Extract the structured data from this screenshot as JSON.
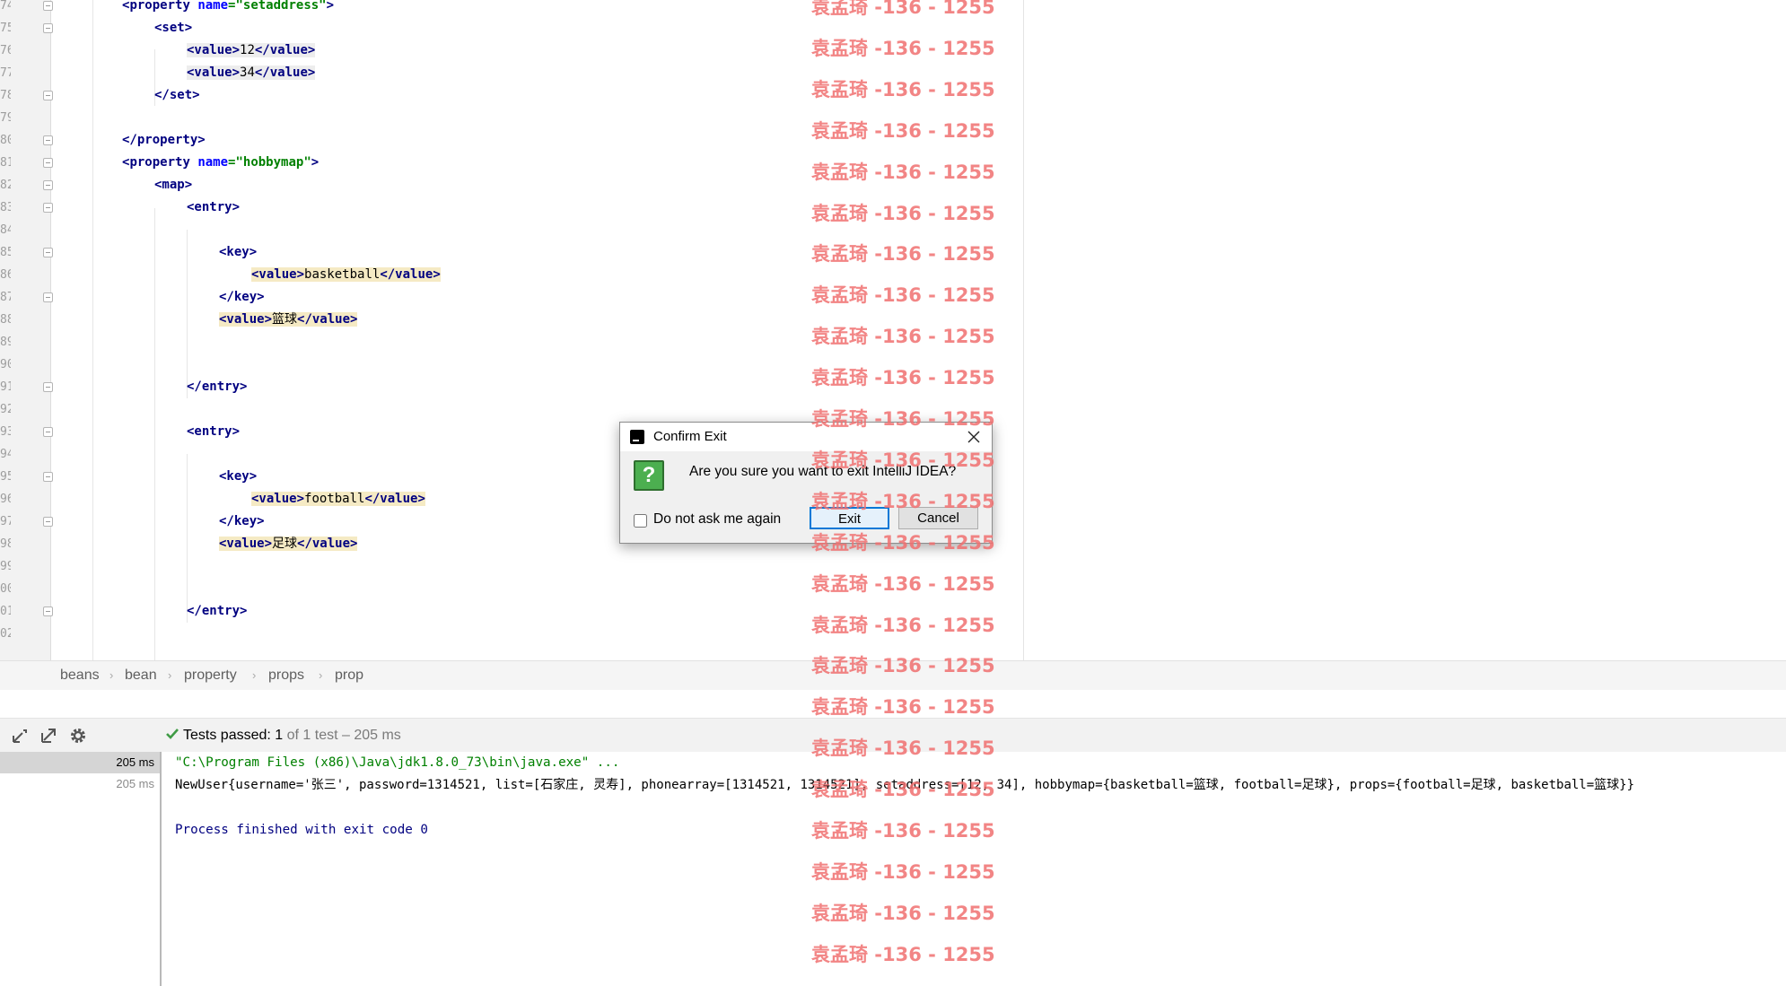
{
  "editor": {
    "line_numbers": [
      "74",
      "75",
      "76",
      "77",
      "78",
      "79",
      "80",
      "81",
      "82",
      "83",
      "84",
      "85",
      "86",
      "87",
      "88",
      "89",
      "90",
      "91",
      "92",
      "93",
      "94",
      "95",
      "96",
      "97",
      "98",
      "99",
      "00",
      "01",
      "02"
    ],
    "lines": [
      [
        {
          "t": "<",
          "c": "tag"
        },
        {
          "t": "property",
          "c": "tag"
        },
        {
          "t": " "
        },
        {
          "t": "name",
          "c": "an"
        },
        {
          "t": "=\"setaddress\"",
          "c": "av"
        },
        {
          "t": ">",
          "c": "tag"
        }
      ],
      [
        {
          "t": "<set>",
          "c": "tag"
        }
      ],
      [
        {
          "t": "<value>",
          "c": "tag"
        },
        {
          "t": "12"
        },
        {
          "t": "</value>",
          "c": "tag"
        }
      ],
      [
        {
          "t": "<value>",
          "c": "tag"
        },
        {
          "t": "34"
        },
        {
          "t": "</value>",
          "c": "tag"
        }
      ],
      [
        {
          "t": "</set>",
          "c": "tag"
        }
      ],
      [],
      [
        {
          "t": "</property>",
          "c": "tag"
        }
      ],
      [
        {
          "t": "<",
          "c": "tag"
        },
        {
          "t": "property",
          "c": "tag"
        },
        {
          "t": " "
        },
        {
          "t": "name",
          "c": "an"
        },
        {
          "t": "=\"hobbymap\"",
          "c": "av"
        },
        {
          "t": ">",
          "c": "tag"
        }
      ],
      [
        {
          "t": "<map>",
          "c": "tag"
        }
      ],
      [
        {
          "t": "<entry>",
          "c": "tag"
        }
      ],
      [],
      [
        {
          "t": "<key>",
          "c": "tag"
        }
      ],
      [
        {
          "t": "<value>",
          "c": "tag"
        },
        {
          "t": "basketball"
        },
        {
          "t": "</value>",
          "c": "tag"
        }
      ],
      [
        {
          "t": "</key>",
          "c": "tag"
        }
      ],
      [
        {
          "t": "<value>",
          "c": "tag"
        },
        {
          "t": "篮球"
        },
        {
          "t": "</value>",
          "c": "tag"
        }
      ],
      [],
      [],
      [
        {
          "t": "</entry>",
          "c": "tag"
        }
      ],
      [],
      [
        {
          "t": "<entry>",
          "c": "tag"
        }
      ],
      [],
      [
        {
          "t": "<key>",
          "c": "tag"
        }
      ],
      [
        {
          "t": "<value>",
          "c": "tag"
        },
        {
          "t": "football"
        },
        {
          "t": "</value>",
          "c": "tag"
        }
      ],
      [
        {
          "t": "</key>",
          "c": "tag"
        }
      ],
      [
        {
          "t": "<value>",
          "c": "tag"
        },
        {
          "t": "足球"
        },
        {
          "t": "</value>",
          "c": "tag"
        }
      ],
      [],
      [],
      [
        {
          "t": "</entry>",
          "c": "tag"
        }
      ],
      []
    ]
  },
  "breadcrumb": [
    "beans",
    "bean",
    "property",
    "props",
    "prop"
  ],
  "run_panel": {
    "status_strong": "Tests passed: 1",
    "status_muted": " of 1 test – 205 ms",
    "durations": [
      "205 ms",
      "205 ms"
    ],
    "console_lines": [
      "\"C:\\Program Files (x86)\\Java\\jdk1.8.0_73\\bin\\java.exe\" ...",
      "NewUser{username='张三', password=1314521, list=[石家庄, 灵寿], phonearray=[1314521, 1314521], setaddress=[12, 34], hobbymap={basketball=篮球, football=足球}, props={football=足球, basketball=篮球}}",
      "",
      "Process finished with exit code 0"
    ],
    "colors": {
      "command": "#008000",
      "output": "#000000",
      "exit": "#000080"
    }
  },
  "dialog": {
    "title": "Confirm Exit",
    "message": "Are you sure you want to exit IntelliJ IDEA?",
    "checkbox_label": "Do not ask me again",
    "checkbox_checked": false,
    "exit_label": "Exit",
    "cancel_label": "Cancel",
    "question_icon": "?"
  },
  "watermark": "袁孟琦 -136 - 1255",
  "colors": {
    "tag": "#000080",
    "attr_name": "#0000ff",
    "attr_value": "#008000",
    "highlight": "#f5eac4",
    "watermark": "#f07070",
    "accent": "#0078d7"
  }
}
